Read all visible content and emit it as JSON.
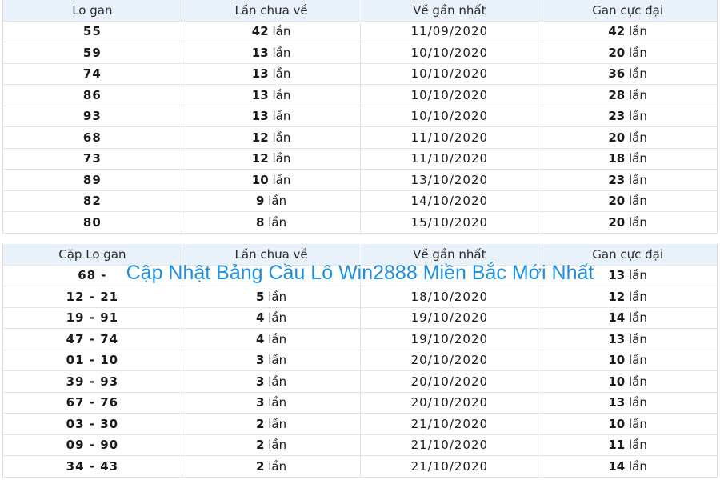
{
  "table1": {
    "headers": [
      "Lo gan",
      "Lần chưa về",
      "Về gần nhất",
      "Gan cực đại"
    ],
    "rows": [
      {
        "num": "55",
        "count": "42",
        "date": "11/09/2020",
        "max": "42"
      },
      {
        "num": "59",
        "count": "13",
        "date": "10/10/2020",
        "max": "20"
      },
      {
        "num": "74",
        "count": "13",
        "date": "10/10/2020",
        "max": "36"
      },
      {
        "num": "86",
        "count": "13",
        "date": "10/10/2020",
        "max": "28"
      },
      {
        "num": "93",
        "count": "13",
        "date": "10/10/2020",
        "max": "23"
      },
      {
        "num": "68",
        "count": "12",
        "date": "11/10/2020",
        "max": "20"
      },
      {
        "num": "73",
        "count": "12",
        "date": "11/10/2020",
        "max": "18"
      },
      {
        "num": "89",
        "count": "10",
        "date": "13/10/2020",
        "max": "23"
      },
      {
        "num": "82",
        "count": "9",
        "date": "14/10/2020",
        "max": "20"
      },
      {
        "num": "80",
        "count": "8",
        "date": "15/10/2020",
        "max": "20"
      }
    ]
  },
  "table2": {
    "headers": [
      "Cặp Lo gan",
      "Lần chưa về",
      "Về gần nhất",
      "Gan cực đại"
    ],
    "rows": [
      {
        "num": "68 -",
        "count": "",
        "date": "",
        "max": "13"
      },
      {
        "num": "12 - 21",
        "count": "5",
        "date": "18/10/2020",
        "max": "12"
      },
      {
        "num": "19 - 91",
        "count": "4",
        "date": "19/10/2020",
        "max": "14"
      },
      {
        "num": "47 - 74",
        "count": "4",
        "date": "19/10/2020",
        "max": "13"
      },
      {
        "num": "01 - 10",
        "count": "3",
        "date": "20/10/2020",
        "max": "10"
      },
      {
        "num": "39 - 93",
        "count": "3",
        "date": "20/10/2020",
        "max": "10"
      },
      {
        "num": "67 - 76",
        "count": "3",
        "date": "20/10/2020",
        "max": "13"
      },
      {
        "num": "03 - 30",
        "count": "2",
        "date": "21/10/2020",
        "max": "10"
      },
      {
        "num": "09 - 90",
        "count": "2",
        "date": "21/10/2020",
        "max": "11"
      },
      {
        "num": "34 - 43",
        "count": "2",
        "date": "21/10/2020",
        "max": "14"
      }
    ]
  },
  "unit": "lần",
  "overlay_title": "Cập Nhật Bảng Cầu Lô Win2888 Miền Bắc Mới Nhất",
  "colors": {
    "header_bg": "#e9f1fb",
    "date_text": "#2f5fc4",
    "overlay_title": "#1e90e0"
  }
}
